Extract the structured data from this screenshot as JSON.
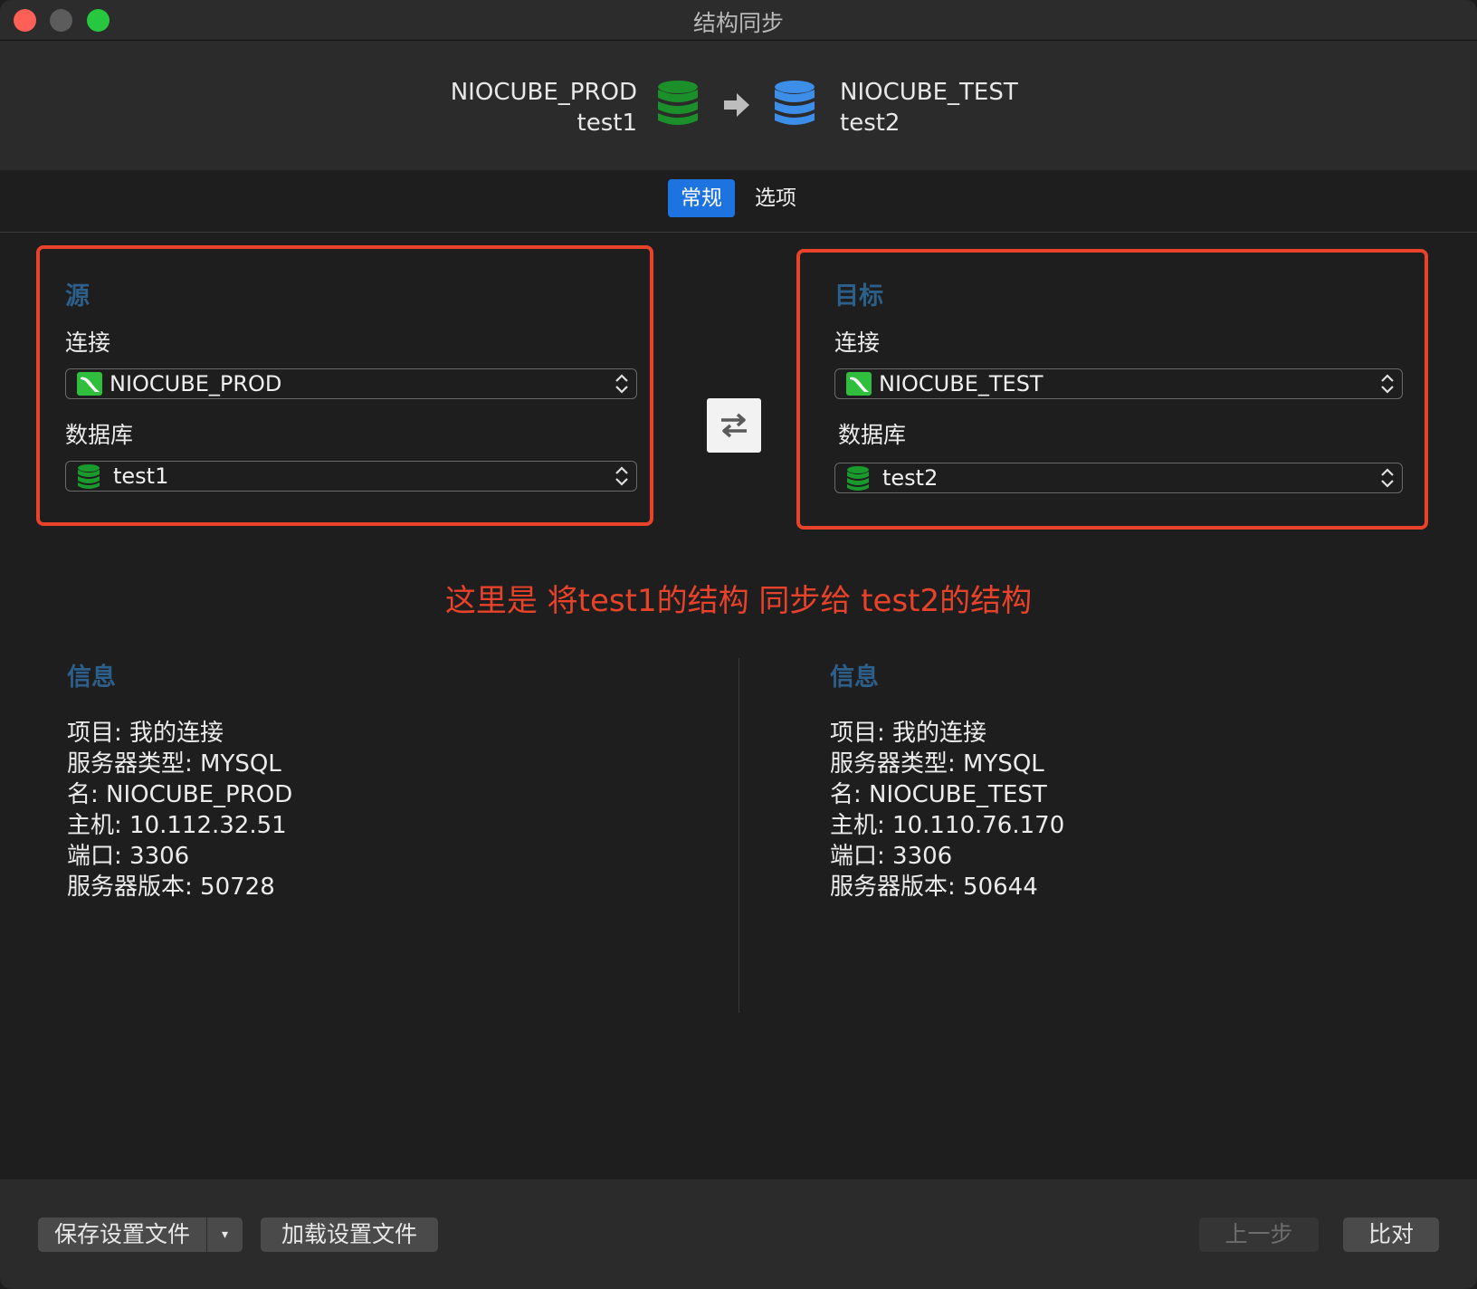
{
  "window": {
    "title": "结构同步"
  },
  "header": {
    "source_connection": "NIOCUBE_PROD",
    "source_database": "test1",
    "target_connection": "NIOCUBE_TEST",
    "target_database": "test2",
    "source_db_color": "#1a8f2a",
    "target_db_color": "#3d8ee8"
  },
  "tabs": [
    {
      "label": "常规",
      "active": true
    },
    {
      "label": "选项",
      "active": false
    }
  ],
  "source": {
    "title": "源",
    "connection_label": "连接",
    "connection_value": "NIOCUBE_PROD",
    "database_label": "数据库",
    "database_value": "test1"
  },
  "target": {
    "title": "目标",
    "connection_label": "连接",
    "connection_value": "NIOCUBE_TEST",
    "database_label": "数据库",
    "database_value": "test2"
  },
  "annotation": "这里是 将test1的结构 同步给 test2的结构",
  "info_source": {
    "title": "信息",
    "lines": [
      "项目: 我的连接",
      "服务器类型: MYSQL",
      "名: NIOCUBE_PROD",
      "主机: 10.112.32.51",
      "端口: 3306",
      "服务器版本: 50728"
    ]
  },
  "info_target": {
    "title": "信息",
    "lines": [
      "项目: 我的连接",
      "服务器类型: MYSQL",
      "名: NIOCUBE_TEST",
      "主机: 10.110.76.170",
      "端口: 3306",
      "服务器版本: 50644"
    ]
  },
  "footer": {
    "save_label": "保存设置文件",
    "save_dropdown": "▾",
    "load_label": "加载设置文件",
    "prev_label": "上一步",
    "compare_label": "比对"
  },
  "colors": {
    "accent": "#1d73e0",
    "annotation_red": "#e8422a",
    "section_title": "#2c5f8a"
  }
}
